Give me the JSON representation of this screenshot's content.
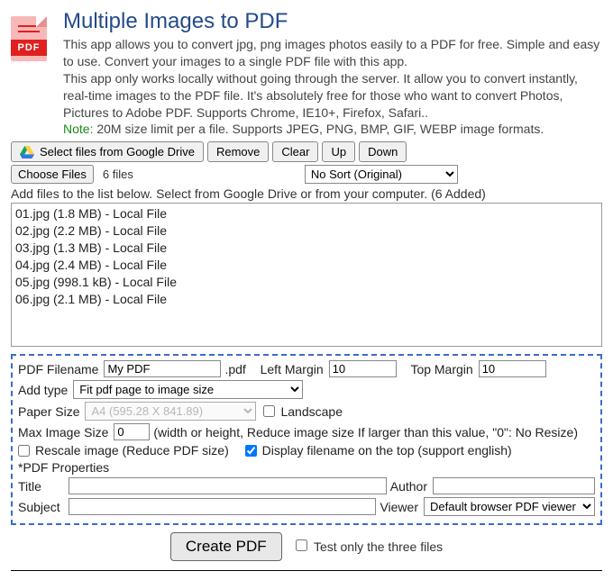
{
  "header": {
    "title": "Multiple Images to PDF",
    "desc1": "This app allows you to convert jpg, png images photos easily to a PDF for free. Simple and easy to use. Convert your images to a single PDF file with this app.",
    "desc2": "This app only works locally without going through the server. It allow you to convert instantly, real-time images to the PDF file. It's absolutely free for those who want to convert Photos, Pictures to Adobe PDF. Supports Chrome, IE10+, Firefox, Safari..",
    "note_label": "Note:",
    "note_text": " 20M size limit per a file. Supports JPEG, PNG, BMP, GIF, WEBP image formats.",
    "icon_band": "PDF"
  },
  "toolbar": {
    "gdrive": "Select files from Google Drive",
    "remove": "Remove",
    "clear": "Clear",
    "up": "Up",
    "down": "Down",
    "choose_files": "Choose Files",
    "file_count": "6 files",
    "sort_selected": "No Sort (Original)"
  },
  "instruction": "Add files to the list below. Select from Google Drive or from your computer. (6 Added)",
  "files": [
    "01.jpg (1.8 MB) - Local File",
    "02.jpg (2.2 MB) - Local File",
    "03.jpg (1.3 MB) - Local File",
    "04.jpg (2.4 MB) - Local File",
    "05.jpg (998.1 kB) - Local File",
    "06.jpg (2.1 MB) - Local File"
  ],
  "settings": {
    "pdf_filename_label": "PDF Filename",
    "pdf_filename": "My PDF",
    "pdf_ext": ".pdf",
    "left_margin_label": "Left Margin",
    "left_margin": "10",
    "top_margin_label": "Top Margin",
    "top_margin": "10",
    "add_type_label": "Add type",
    "add_type": "Fit pdf page to image size",
    "paper_size_label": "Paper Size",
    "paper_size": "A4 (595.28 X 841.89)",
    "landscape_label": "Landscape",
    "max_img_label": "Max Image Size",
    "max_img": "0",
    "max_img_hint": "(width or height, Reduce image size If larger than this value, \"0\": No Resize)",
    "rescale_label": "Rescale image (Reduce PDF size)",
    "display_fn_label": "Display filename on the top (support english)",
    "props_label": "*PDF Properties",
    "title_label": "Title",
    "title": "",
    "author_label": "Author",
    "author": "",
    "subject_label": "Subject",
    "subject": "",
    "viewer_label": "Viewer",
    "viewer": "Default browser PDF viewer"
  },
  "action": {
    "create": "Create PDF",
    "test_label": "Test only the three files"
  }
}
